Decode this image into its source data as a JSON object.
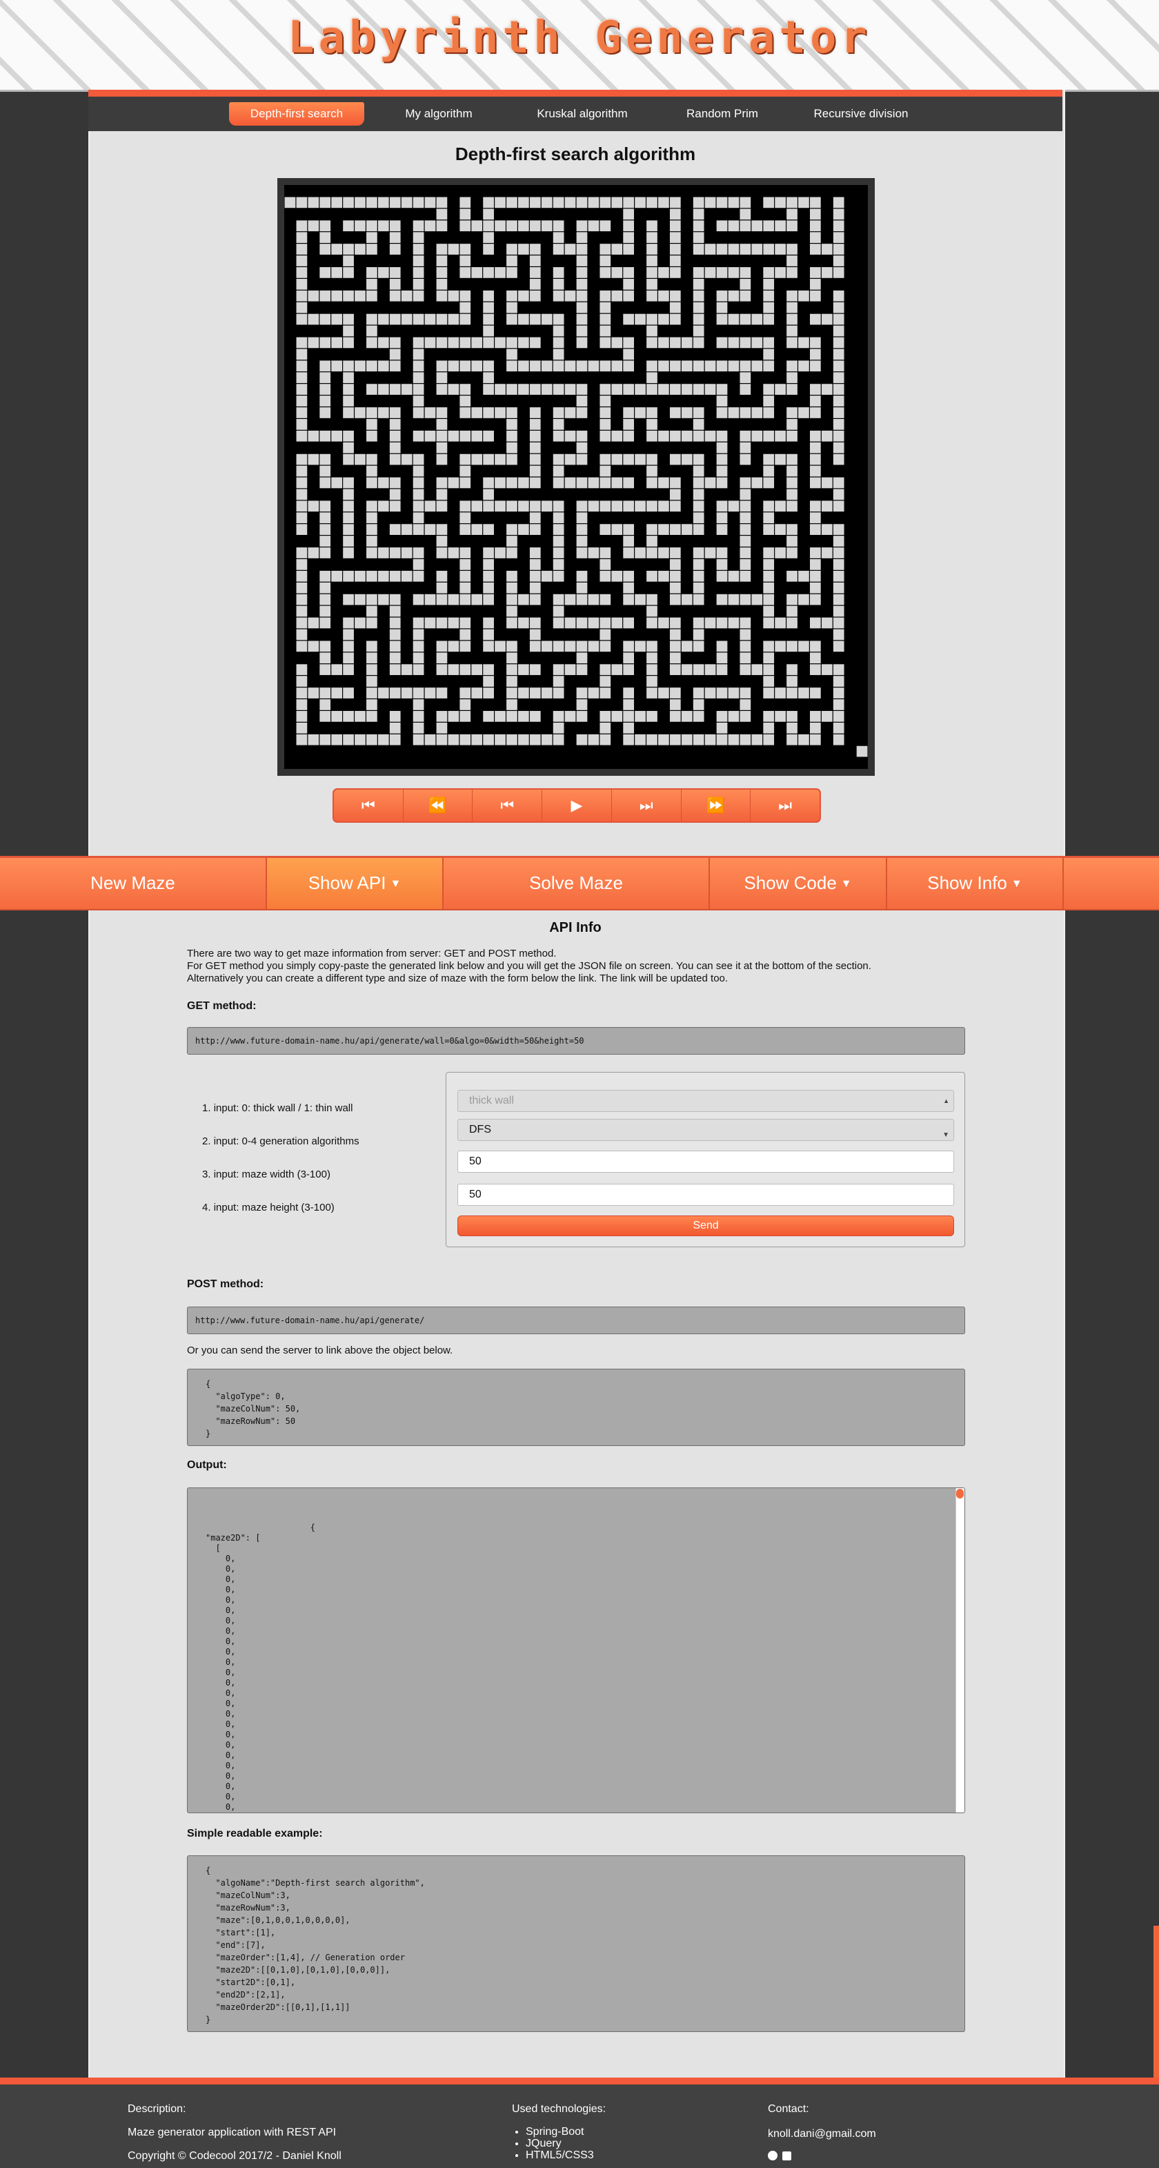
{
  "header": {
    "title": "Labyrinth Generator"
  },
  "algo_nav": {
    "tabs": [
      "Depth-first search",
      "My algorithm",
      "Kruskal algorithm",
      "Random Prim",
      "Recursive division"
    ],
    "active_index": 0
  },
  "maze": {
    "title": "Depth-first search algorithm",
    "rows": 50,
    "cols": 50,
    "wall_color": "#000000",
    "path_color": "#d7d7d7",
    "frame_color": "#333333"
  },
  "player_controls": [
    "first-icon",
    "rewind-icon",
    "step-back-icon",
    "play-icon",
    "step-forward-icon",
    "fast-forward-icon",
    "last-icon"
  ],
  "menu": {
    "items": [
      "New Maze",
      "Show API",
      "Solve Maze",
      "Show Code",
      "Show Info"
    ],
    "active_index": 1,
    "dropdown_items": [
      1,
      3,
      4
    ]
  },
  "api": {
    "title": "API Info",
    "intro": [
      "There are two way to get maze information from server: GET and POST method.",
      "For GET method you simply copy-paste the generated link below and you will get the JSON file on screen. You can see it at the bottom of the section.",
      "Alternatively you can create a different type and size of maze with the form below the link. The link will be updated too."
    ],
    "get_label": "GET method:",
    "get_link": "http://www.future-domain-name.hu/api/generate/wall=0&algo=0&width=50&height=50",
    "inputs": [
      "input: 0: thick wall / 1: thin wall",
      "input: 0-4 generation algorithms",
      "input: maze width (3-100)",
      "input: maze height (3-100)"
    ],
    "form": {
      "wall_select": "thick wall",
      "algo_select": "DFS",
      "width_value": "50",
      "height_value": "50",
      "send_label": "Send"
    },
    "post_label": "POST method:",
    "post_link": "http://www.future-domain-name.hu/api/generate/",
    "post_note": "Or you can send the server to link above the object below.",
    "post_body": "{\n  \"algoType\": 0,\n  \"mazeColNum\": 50,\n  \"mazeRowNum\": 50\n}",
    "output_label": "Output:",
    "output_text": "                     {\n\"maze2D\": [\n  [\n    0,\n    0,\n    0,\n    0,\n    0,\n    0,\n    0,\n    0,\n    0,\n    0,\n    0,\n    0,\n    0,\n    0,\n    0,\n    0,\n    0,\n    0,\n    0,\n    0,\n    0,\n    0,\n    0,\n    0,\n    0,\n    0,\n    0,\n    0,",
    "example_label": "Simple readable example:",
    "example_text": "{\n  \"algoName\":\"Depth-first search algorithm\",\n  \"mazeColNum\":3,\n  \"mazeRowNum\":3,\n  \"maze\":[0,1,0,0,1,0,0,0,0],\n  \"start\":[1],\n  \"end\":[7],\n  \"mazeOrder\":[1,4], // Generation order\n  \"maze2D\":[[0,1,0],[0,1,0],[0,0,0]],\n  \"start2D\":[0,1],\n  \"end2D\":[2,1],\n  \"mazeOrder2D\":[[0,1],[1,1]]\n}"
  },
  "footer": {
    "description_title": "Description:",
    "description": "Maze generator application with REST API",
    "copyright": "Copyright © Codecool 2017/2 - Daniel Knoll",
    "tech_title": "Used technologies:",
    "technologies": [
      "Spring-Boot",
      "JQuery",
      "HTML5/CSS3"
    ],
    "contact_title": "Contact:",
    "email": "knoll.dani@gmail.com",
    "social_icons": [
      "github-icon",
      "linkedin-icon"
    ]
  },
  "colors": {
    "accent": "#f46a3e",
    "accent_light": "#ff8d58",
    "dark_bg": "#363636",
    "panel_bg": "#e3e3e3",
    "code_bg": "#a9a9a9"
  }
}
